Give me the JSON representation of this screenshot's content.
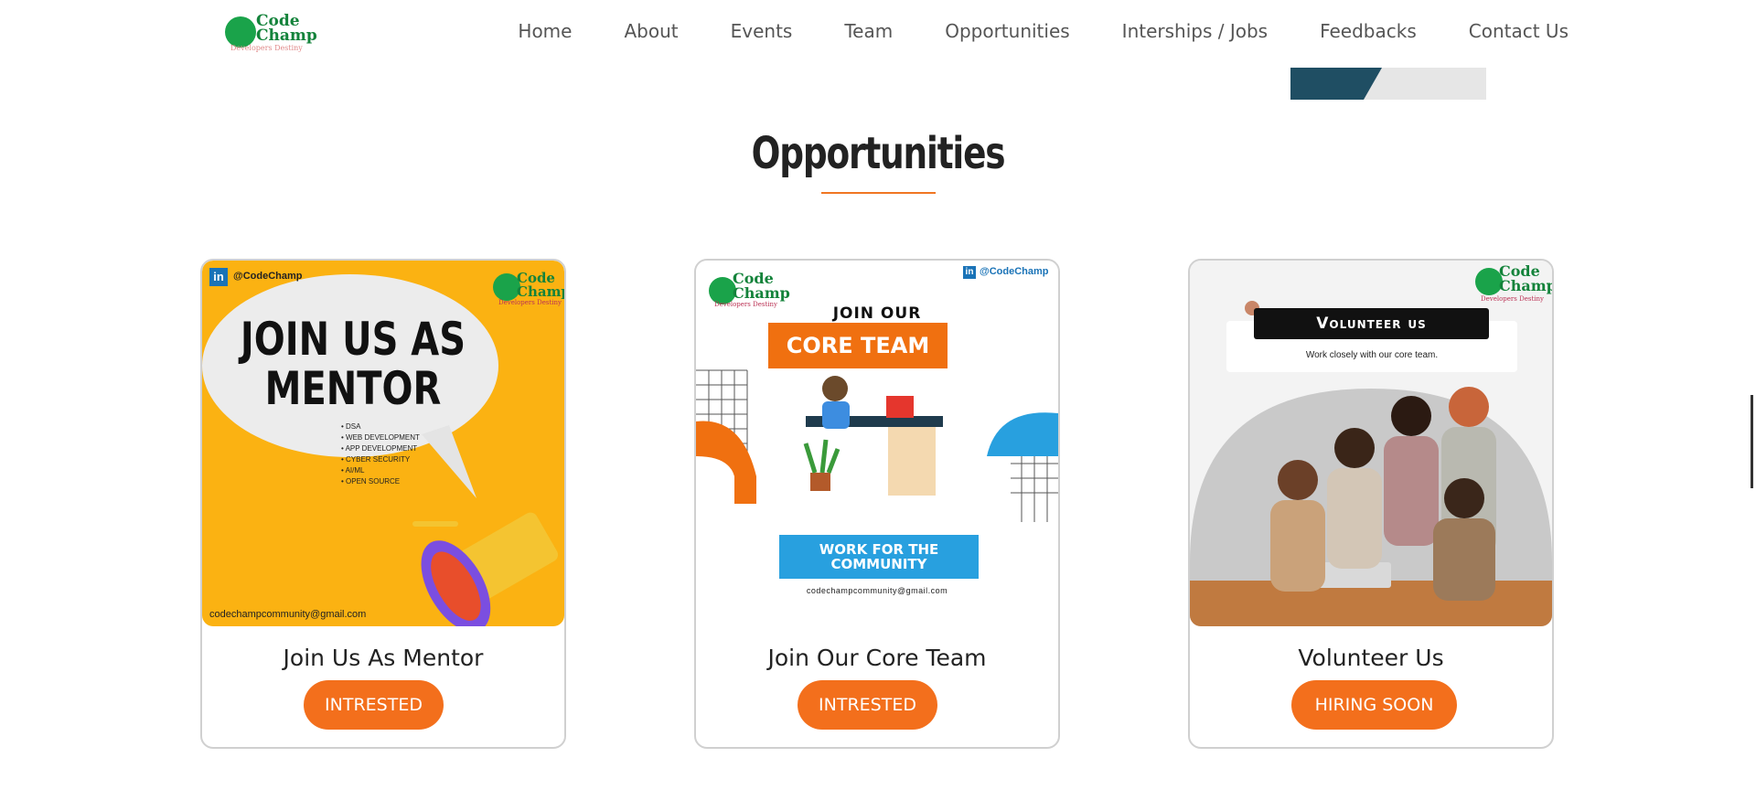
{
  "nav": {
    "logo": {
      "line1": "Code",
      "line2": "Champ",
      "tagline": "Developers Destiny"
    },
    "items": [
      {
        "label": "Home"
      },
      {
        "label": "About"
      },
      {
        "label": "Events"
      },
      {
        "label": "Team"
      },
      {
        "label": "Opportunities"
      },
      {
        "label": "Interships / Jobs"
      },
      {
        "label": "Feedbacks"
      },
      {
        "label": "Contact Us"
      }
    ]
  },
  "section": {
    "title": "Opportunities"
  },
  "cards": [
    {
      "label": "Join Us As Mentor",
      "button": "INTRESTED",
      "poster": {
        "handle": "@CodeChamp",
        "heading1": "JOIN US AS",
        "heading2": "MENTOR",
        "bullets": [
          "• DSA",
          "• WEB DEVELOPMENT",
          "• APP DEVELOPMENT",
          "• CYBER SECURITY",
          "• AI/ML",
          "• OPEN SOURCE"
        ],
        "email": "codechampcommunity@gmail.com",
        "logo_line1": "Code",
        "logo_line2": "Champ",
        "logo_tag": "Developers Destiny"
      }
    },
    {
      "label": "Join Our Core Team",
      "button": "INTRESTED",
      "poster": {
        "handle": "@CodeChamp",
        "heading1": "JOIN OUR",
        "heading2": "CORE TEAM",
        "banner1": "WORK FOR THE",
        "banner2": "COMMUNITY",
        "email": "codechampcommunity@gmail.com",
        "logo_line1": "Code",
        "logo_line2": "Champ",
        "logo_tag": "Developers Destiny"
      }
    },
    {
      "label": "Volunteer Us",
      "button": "HIRING SOON",
      "poster": {
        "heading": "Volunteer us",
        "sub": "Work closely with our core team.",
        "logo_line1": "Code",
        "logo_line2": "Champ",
        "logo_tag": "Developers Destiny"
      }
    }
  ],
  "colors": {
    "accent": "#f36f1c",
    "brand_green": "#14833b",
    "poster_yellow": "#fbb212",
    "poster_orange": "#f07010",
    "poster_blue": "#28a0df"
  }
}
